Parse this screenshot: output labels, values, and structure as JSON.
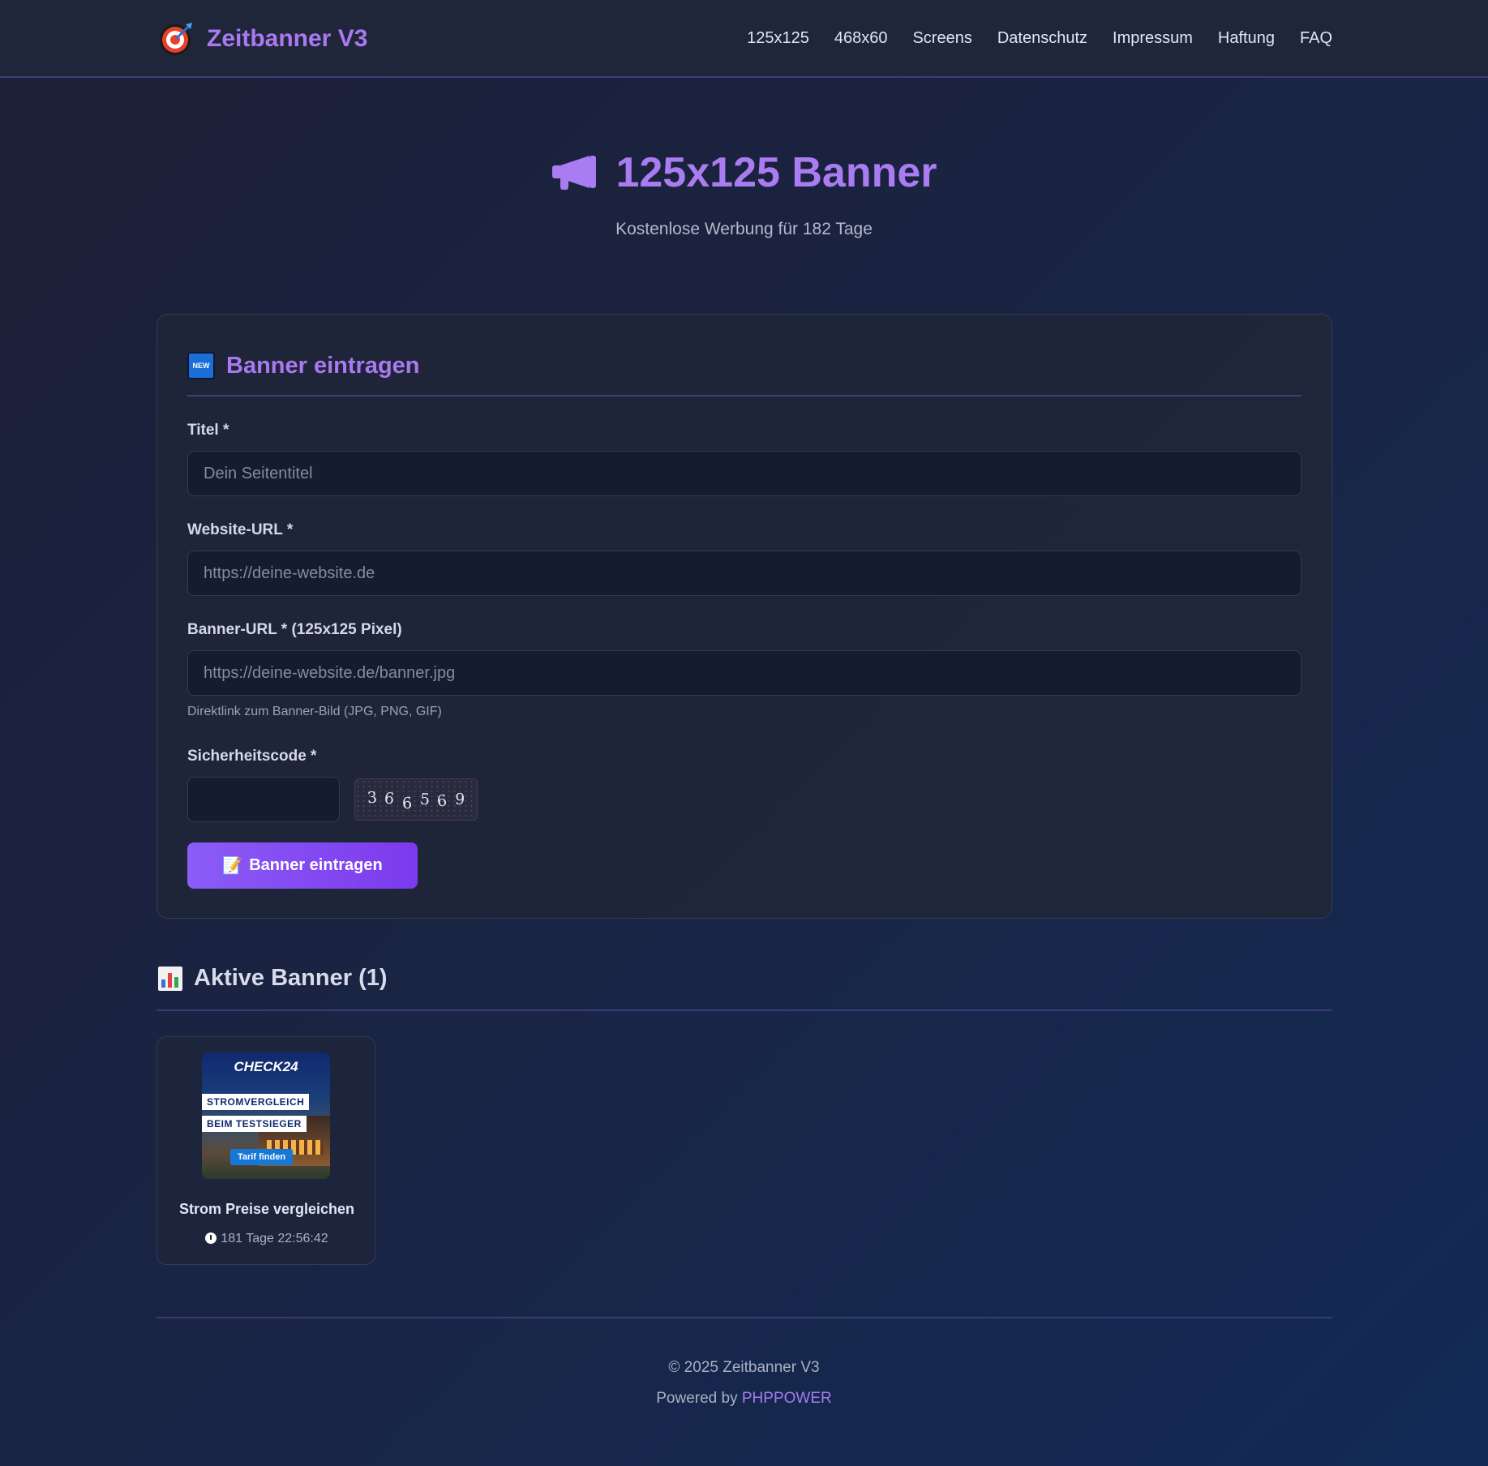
{
  "header": {
    "title": "Zeitbanner V3",
    "nav": [
      "125x125",
      "468x60",
      "Screens",
      "Datenschutz",
      "Impressum",
      "Haftung",
      "FAQ"
    ]
  },
  "hero": {
    "title": "125x125 Banner",
    "subtitle": "Kostenlose Werbung für 182 Tage"
  },
  "form": {
    "heading": "Banner eintragen",
    "badge": "NEW",
    "title_label": "Titel *",
    "title_placeholder": "Dein Seitentitel",
    "url_label": "Website-URL *",
    "url_placeholder": "https://deine-website.de",
    "banner_label": "Banner-URL * (125x125 Pixel)",
    "banner_placeholder": "https://deine-website.de/banner.jpg",
    "banner_hint": "Direktlink zum Banner-Bild (JPG, PNG, GIF)",
    "captcha_label": "Sicherheitscode *",
    "captcha_digits": [
      "3",
      "6",
      "6",
      "5",
      "6",
      "9"
    ],
    "submit_label": "Banner eintragen"
  },
  "active": {
    "heading": "Aktive Banner (1)",
    "banners": [
      {
        "image_logo": "CHECK24",
        "image_line1": "STROMVERGLEICH",
        "image_line2": "BEIM TESTSIEGER",
        "image_cta": "Tarif finden",
        "name": "Strom Preise vergleichen",
        "timer": "181 Tage 22:56:42"
      }
    ]
  },
  "footer": {
    "copyright": "© 2025 Zeitbanner V3",
    "powered_prefix": "Powered by",
    "powered_link": "PHPPOWER"
  },
  "colors": {
    "accent": "#a979f0",
    "button": "#8b5cf6",
    "background": "#1a2444"
  }
}
